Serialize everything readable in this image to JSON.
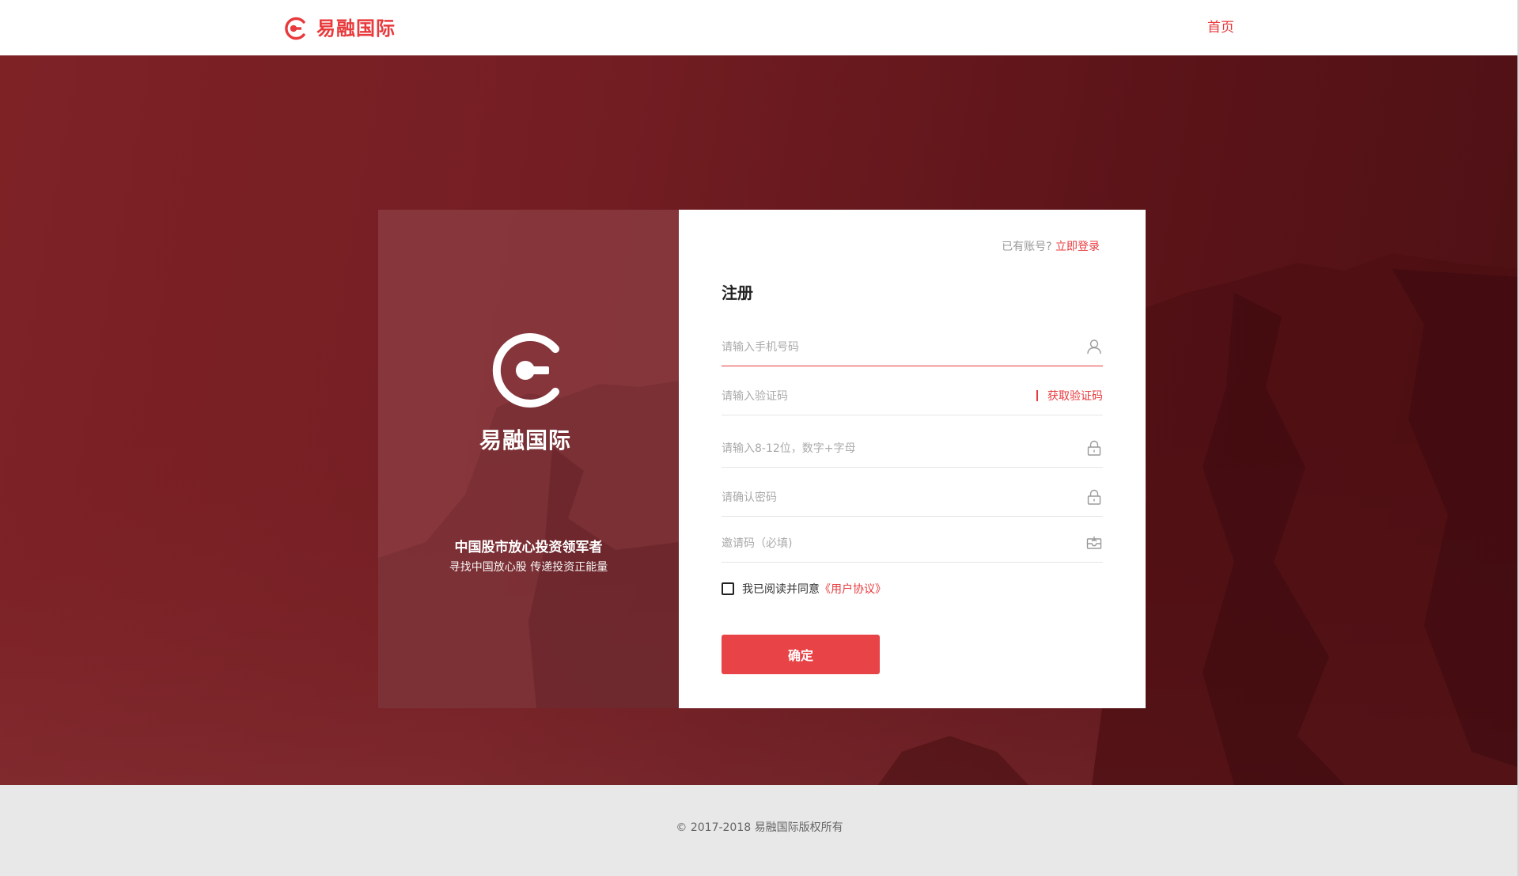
{
  "header": {
    "brand": "易融国际",
    "nav_home": "首页"
  },
  "brand_panel": {
    "brand": "易融国际",
    "slogan_main": "中国股市放心投资领军者",
    "slogan_sub": "寻找中国放心股 传递投资正能量"
  },
  "form": {
    "login_question": "已有账号?",
    "login_link": "立即登录",
    "title": "注册",
    "phone_placeholder": "请输入手机号码",
    "code_placeholder": "请输入验证码",
    "get_code_label": "获取验证码",
    "password_placeholder": "请输入8-12位，数字+字母",
    "confirm_placeholder": "请确认密码",
    "invite_placeholder": "邀请码（必填)",
    "agree_text": "我已阅读并同意",
    "agree_link": "《用户协议》",
    "agree_checked": false,
    "submit_label": "确定"
  },
  "icons": {
    "phone_field": "user-icon",
    "password_field": "lock-icon",
    "confirm_field": "lock-icon",
    "invite_field": "invite-icon"
  },
  "colors": {
    "accent": "#e8393c",
    "hero_bg": "#741e23",
    "footer_bg": "#e9e8e9"
  },
  "footer": {
    "copyright": "© 2017-2018 易融国际版权所有"
  }
}
